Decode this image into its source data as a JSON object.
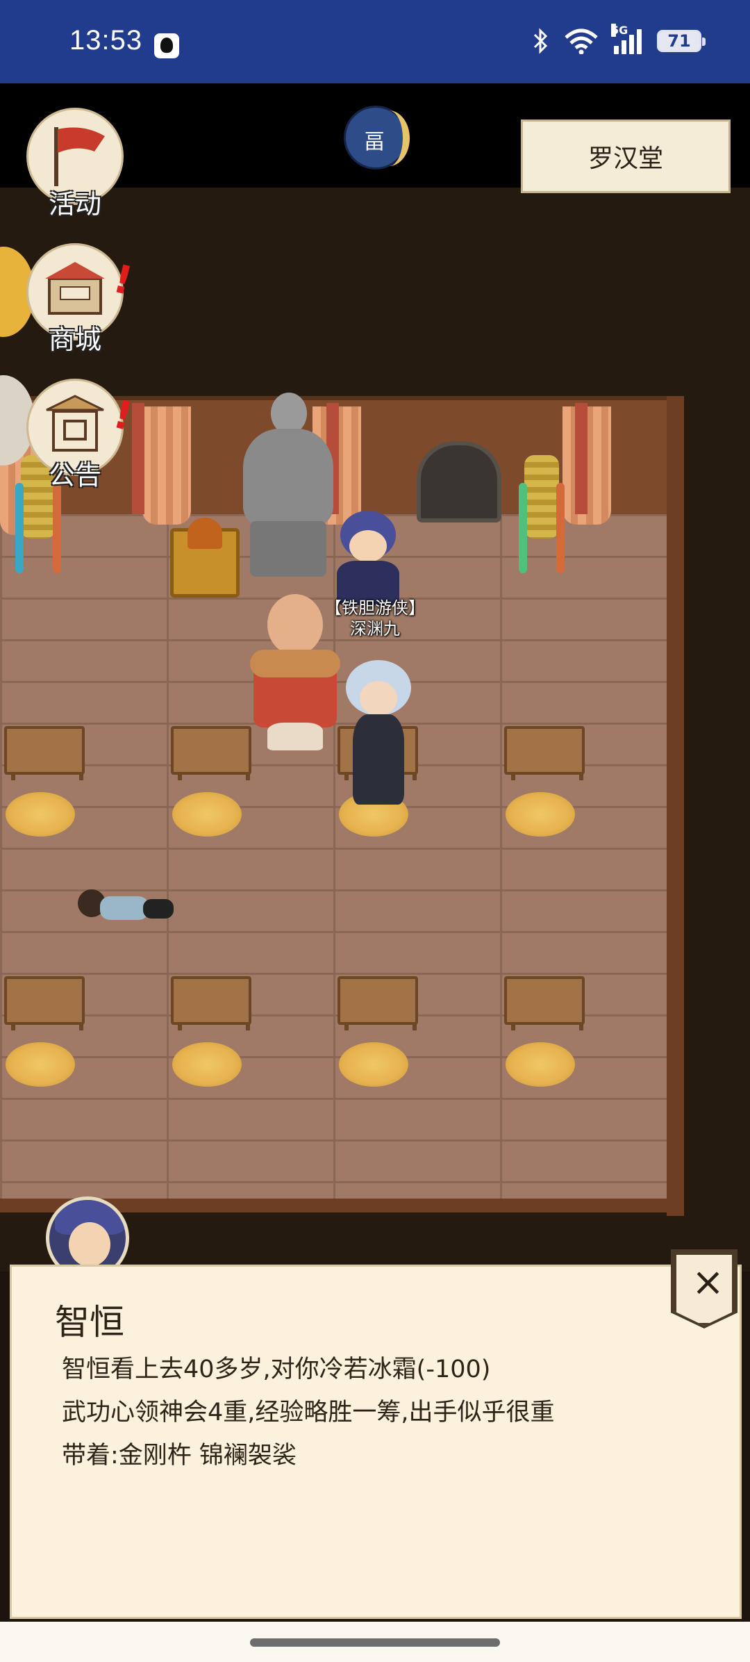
{
  "status_bar": {
    "time": "13:53",
    "network_label": "5G",
    "battery": "71",
    "icons": [
      "qq-icon",
      "bluetooth-icon",
      "wifi-icon",
      "signal-icon",
      "battery-icon"
    ]
  },
  "menu": {
    "items": [
      {
        "label": "活动",
        "icon": "banner-flag-icon"
      },
      {
        "label": "商城",
        "icon": "shop-stall-icon",
        "alert": "!"
      },
      {
        "label": "公告",
        "icon": "notice-board-icon",
        "alert": "!"
      }
    ]
  },
  "top": {
    "moon_char": "畐",
    "location": "罗汉堂"
  },
  "scene": {
    "player_title": "【铁胆游侠】",
    "player_name": "深渊九"
  },
  "info_panel": {
    "name": "智恒",
    "lines": [
      "智恒看上去40多岁,对你冷若冰霜(-100)",
      "武功心领神会4重,经验略胜一筹,出手似乎很重",
      "带着:金刚杵 锦襕袈裟"
    ],
    "close": "×"
  },
  "colors": {
    "status_bar": "#223c8d",
    "panel_bg": "#fbf1dd",
    "floor": "#a07a66",
    "alert": "#e01c1c"
  }
}
